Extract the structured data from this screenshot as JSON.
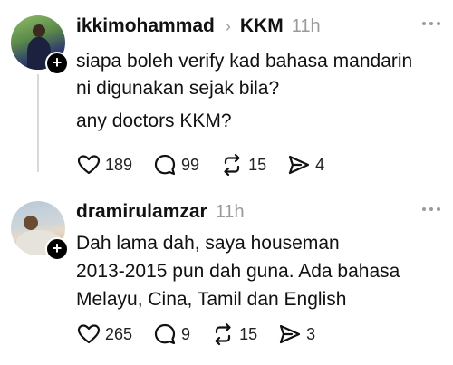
{
  "posts": [
    {
      "username": "ikkimohammad",
      "separator": "›",
      "community": "KKM",
      "time": "11h",
      "lines": [
        "siapa boleh verify kad bahasa mandarin",
        "ni digunakan sejak bila?",
        "any doctors KKM?"
      ],
      "actions": {
        "likes": "189",
        "replies": "99",
        "reposts": "15",
        "shares": "4"
      }
    },
    {
      "username": "dramirulamzar",
      "time": "11h",
      "lines": [
        "Dah lama dah, saya houseman",
        "2013-2015 pun dah guna. Ada bahasa",
        "Melayu, Cina, Tamil dan English"
      ],
      "actions": {
        "likes": "265",
        "replies": "9",
        "reposts": "15",
        "shares": "3"
      }
    }
  ],
  "icons": {
    "like": "heart-icon",
    "reply": "comment-icon",
    "repost": "repost-icon",
    "share": "send-icon",
    "more": "more-icon",
    "follow": "plus-icon"
  },
  "colors": {
    "text": "#111111",
    "muted": "#9a9a9a",
    "badge": "#000000",
    "thread_line": "#d9d9d9"
  }
}
